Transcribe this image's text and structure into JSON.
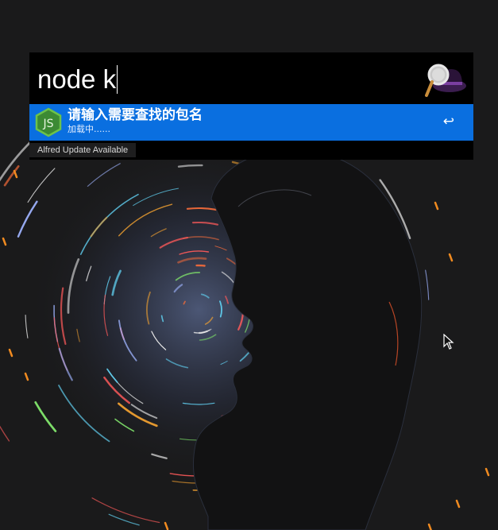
{
  "search": {
    "query": "node k"
  },
  "result": {
    "title": "请输入需要查找的包名",
    "subtitle": "加载中......",
    "shortcut_glyph": "↩",
    "icon": "nodejs-hexagon-icon"
  },
  "footer": {
    "update_label": "Alfred Update Available"
  },
  "icons": {
    "logo": "alfred-hat-magnifier-icon",
    "cursor": "mouse-pointer-icon"
  },
  "colors": {
    "selection": "#0a6fe0",
    "window_bg": "#000000",
    "desktop_bg": "#1a1a1b",
    "node_green": "#6cc24a"
  }
}
